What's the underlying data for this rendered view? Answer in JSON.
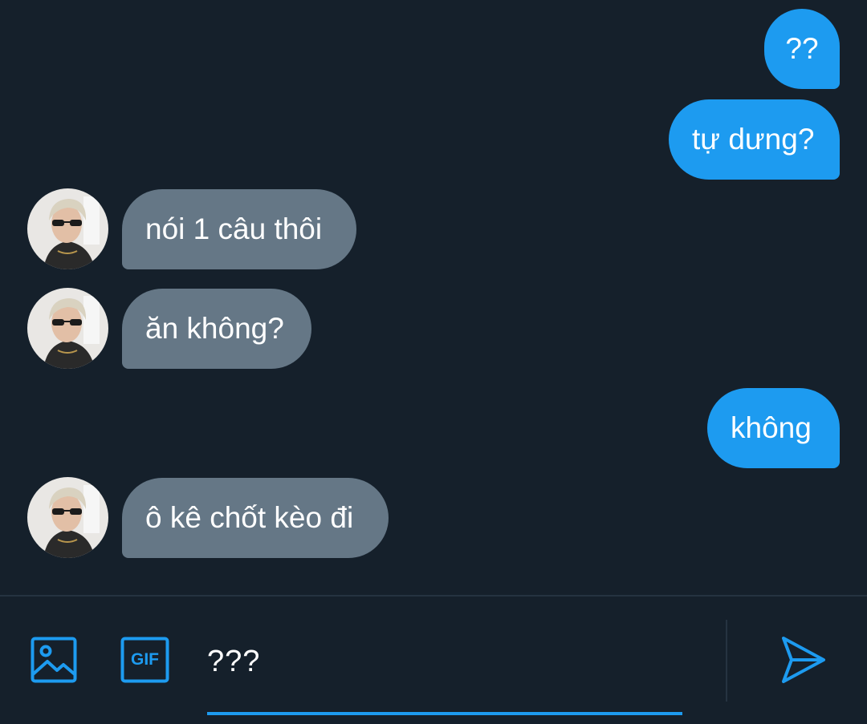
{
  "conversation": {
    "messages": [
      {
        "direction": "outgoing",
        "text": "??"
      },
      {
        "direction": "outgoing",
        "text": "tự dưng?"
      },
      {
        "direction": "incoming",
        "text": "nói 1 câu thôi"
      },
      {
        "direction": "incoming",
        "text": "ăn không?"
      },
      {
        "direction": "outgoing",
        "text": "không"
      },
      {
        "direction": "incoming",
        "text": "ô kê chốt kèo đi"
      }
    ]
  },
  "composer": {
    "value": "???",
    "icons": {
      "media": "image-icon",
      "gif": "gif-icon",
      "send": "send-icon"
    },
    "gif_label": "GIF"
  },
  "colors": {
    "background": "#15202b",
    "outgoing_bubble": "#1d9bf0",
    "incoming_bubble": "#657786",
    "accent": "#1d9bf0",
    "divider": "#253341"
  }
}
